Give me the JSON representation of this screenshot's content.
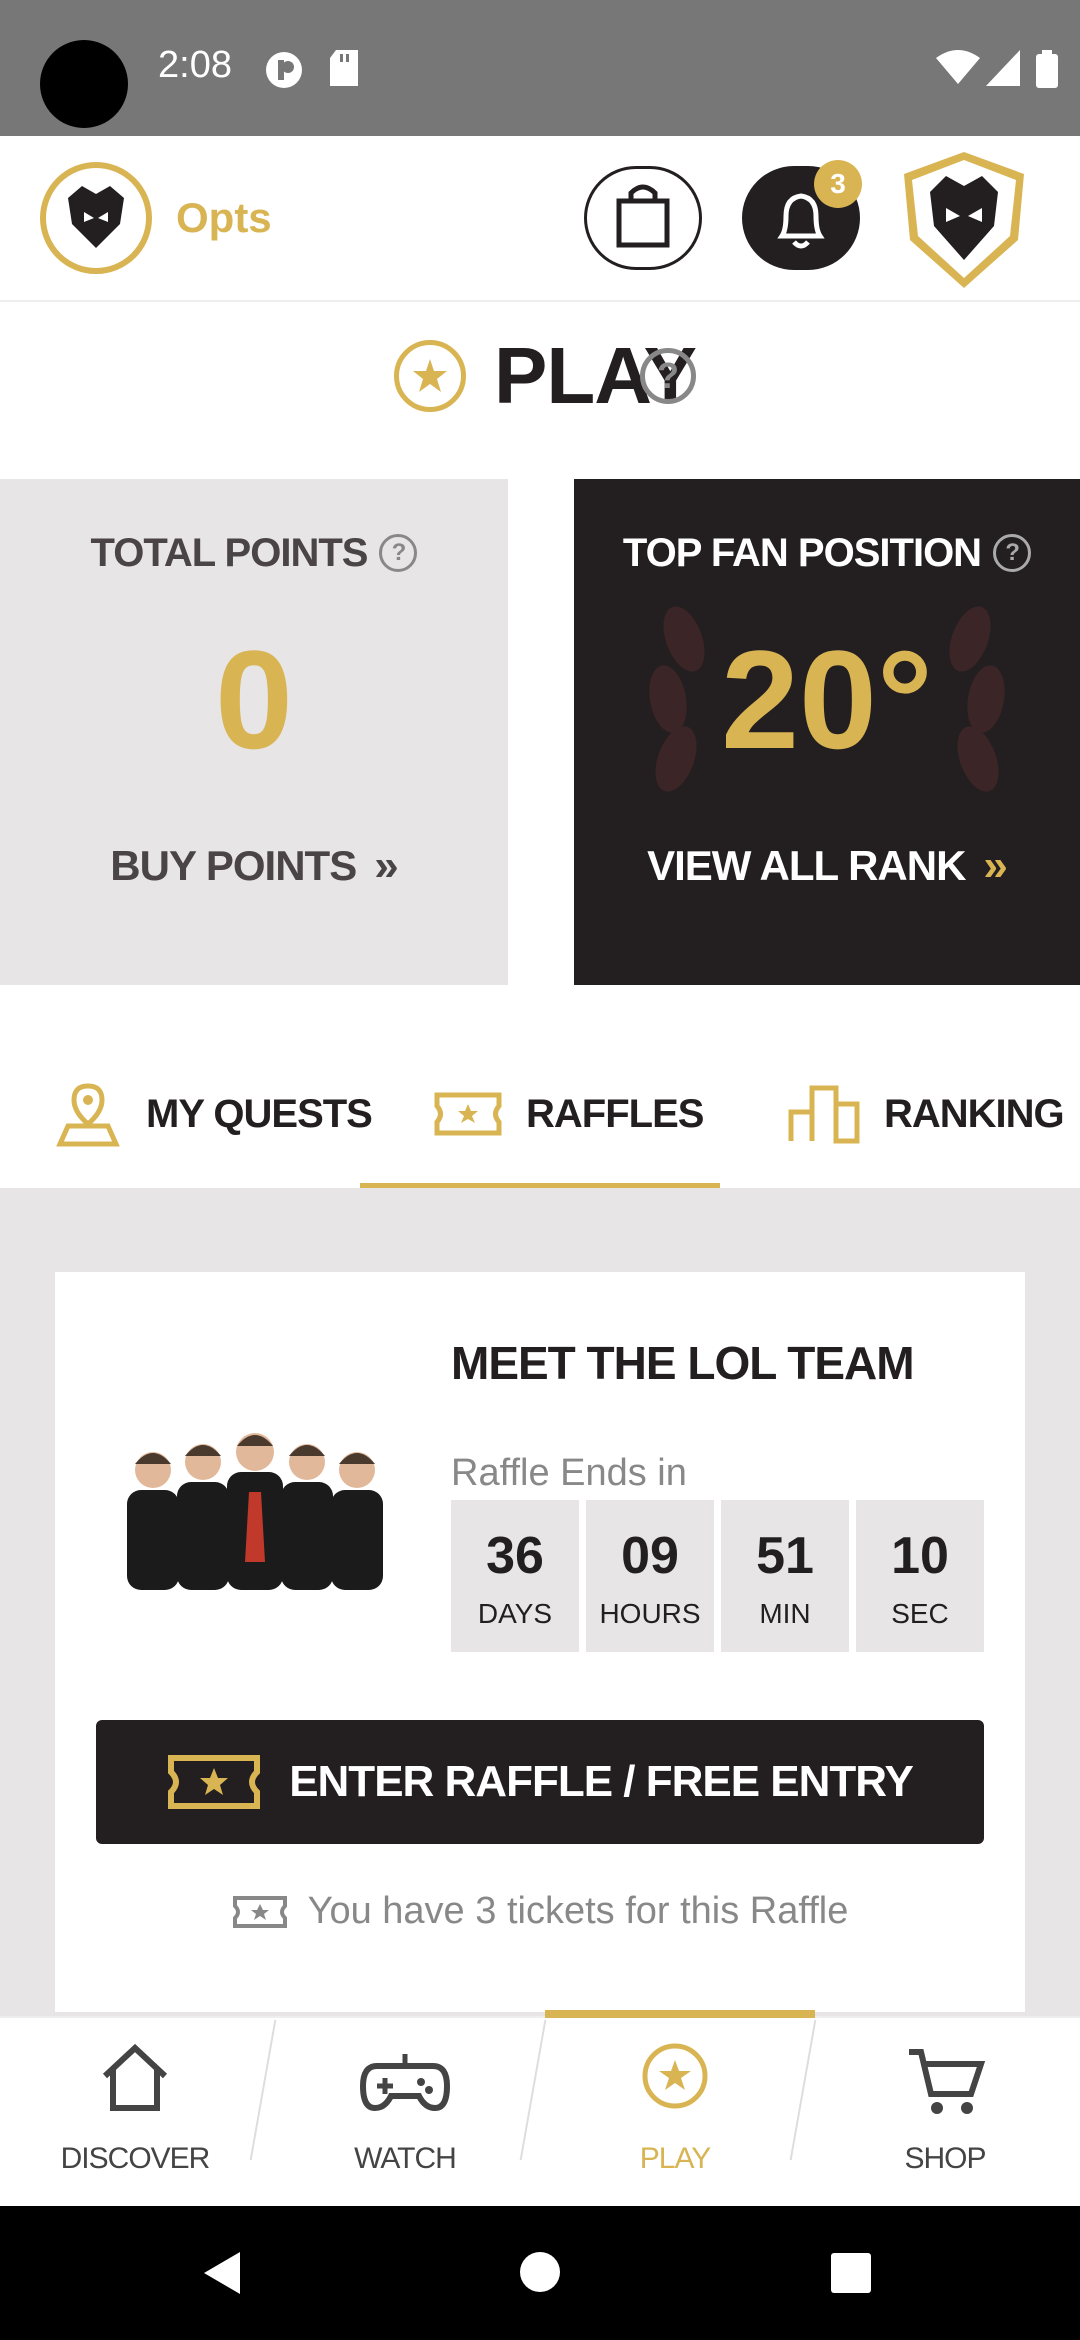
{
  "status_bar": {
    "time": "2:08"
  },
  "header": {
    "username": "Opts",
    "notification_count": "3"
  },
  "page": {
    "title": "PLAY"
  },
  "stats": {
    "total_points_label": "TOTAL POINTS",
    "total_points_value": "0",
    "buy_points_label": "BUY POINTS",
    "top_fan_label": "TOP FAN POSITION",
    "top_fan_value": "20°",
    "view_rank_label": "VIEW ALL RANK"
  },
  "tabs": [
    {
      "label": "MY QUESTS",
      "icon": "map-pin-icon"
    },
    {
      "label": "RAFFLES",
      "icon": "ticket-icon",
      "active": true
    },
    {
      "label": "RANKING",
      "icon": "podium-icon"
    }
  ],
  "raffle": {
    "title": "MEET THE LOL TEAM",
    "ends_label": "Raffle Ends in",
    "countdown": [
      {
        "value": "36",
        "unit": "DAYS"
      },
      {
        "value": "09",
        "unit": "HOURS"
      },
      {
        "value": "51",
        "unit": "MIN"
      },
      {
        "value": "10",
        "unit": "SEC"
      }
    ],
    "enter_button": "ENTER RAFFLE / FREE ENTRY",
    "tickets_note": "You have 3 tickets for this Raffle"
  },
  "bottom_nav": [
    {
      "label": "DISCOVER",
      "icon": "home-icon"
    },
    {
      "label": "WATCH",
      "icon": "gamepad-icon"
    },
    {
      "label": "PLAY",
      "icon": "star-icon",
      "active": true
    },
    {
      "label": "SHOP",
      "icon": "cart-icon"
    }
  ],
  "colors": {
    "accent": "#d9b453",
    "dark": "#231f20",
    "light_gray": "#e7e5e5"
  }
}
